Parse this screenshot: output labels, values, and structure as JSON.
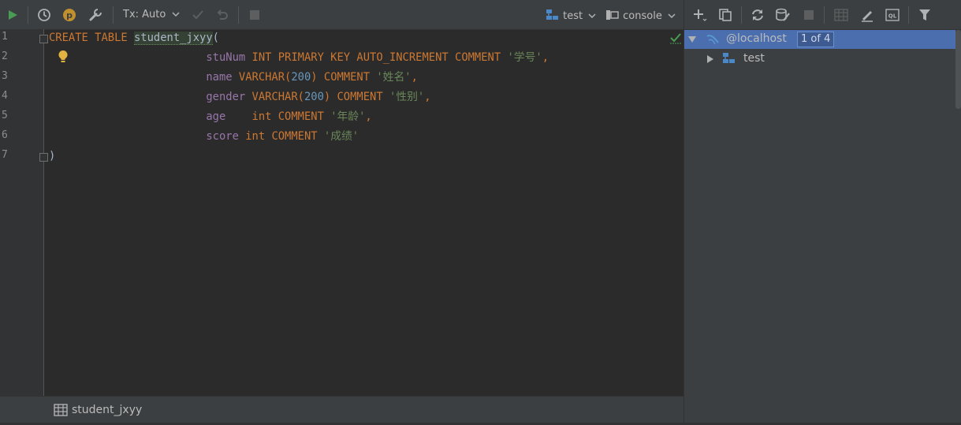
{
  "toolbar": {
    "tx_label": "Tx: Auto",
    "schema_label": "test",
    "console_label": "console"
  },
  "editor": {
    "line_numbers": [
      "1",
      "2",
      "3",
      "4",
      "5",
      "6",
      "7"
    ],
    "lines": [
      [
        {
          "t": "CREATE TABLE ",
          "c": "kw"
        },
        {
          "t": "student_jxyy",
          "c": "tbl"
        },
        {
          "t": "(",
          "c": "ident"
        }
      ],
      [
        {
          "t": "                        ",
          "c": "ident"
        },
        {
          "t": "stuNum",
          "c": "col"
        },
        {
          "t": " INT PRIMARY KEY AUTO_INCREMENT COMMENT ",
          "c": "kw"
        },
        {
          "t": "'学号'",
          "c": "str"
        },
        {
          "t": ",",
          "c": "kw"
        }
      ],
      [
        {
          "t": "                        ",
          "c": "ident"
        },
        {
          "t": "name",
          "c": "col"
        },
        {
          "t": " VARCHAR(",
          "c": "kw"
        },
        {
          "t": "200",
          "c": "num"
        },
        {
          "t": ") COMMENT ",
          "c": "kw"
        },
        {
          "t": "'姓名'",
          "c": "str"
        },
        {
          "t": ",",
          "c": "kw"
        }
      ],
      [
        {
          "t": "                        ",
          "c": "ident"
        },
        {
          "t": "gender",
          "c": "col"
        },
        {
          "t": " VARCHAR(",
          "c": "kw"
        },
        {
          "t": "200",
          "c": "num"
        },
        {
          "t": ") COMMENT ",
          "c": "kw"
        },
        {
          "t": "'性别'",
          "c": "str"
        },
        {
          "t": ",",
          "c": "kw"
        }
      ],
      [
        {
          "t": "                        ",
          "c": "ident"
        },
        {
          "t": "age",
          "c": "col"
        },
        {
          "t": "    int COMMENT ",
          "c": "kw"
        },
        {
          "t": "'年龄'",
          "c": "str"
        },
        {
          "t": ",",
          "c": "kw"
        }
      ],
      [
        {
          "t": "                        ",
          "c": "ident"
        },
        {
          "t": "score",
          "c": "col"
        },
        {
          "t": " int COMMENT ",
          "c": "kw"
        },
        {
          "t": "'成绩'",
          "c": "str"
        }
      ],
      [
        {
          "t": ")",
          "c": "ident"
        }
      ]
    ]
  },
  "footer": {
    "table_name": "student_jxyy"
  },
  "db_tree": {
    "host_label": "@localhost",
    "host_badge": "1 of 4",
    "schema_label": "test"
  },
  "colors": {
    "background": "#2b2b2b",
    "panel": "#3c3f41",
    "selection": "#4b6eaf",
    "keyword": "#cc7832",
    "string": "#6a8759",
    "number": "#6897bb",
    "column": "#9876aa",
    "run_green": "#499c54"
  },
  "icons": [
    "run-icon",
    "history-icon",
    "profile-icon",
    "settings-icon",
    "commit-icon",
    "rollback-icon",
    "stop-icon",
    "schema-icon",
    "console-icon",
    "add-icon",
    "copy-icon",
    "refresh-icon",
    "schema-sync-icon",
    "stop-icon",
    "table-icon",
    "edit-icon",
    "ql-icon",
    "filter-icon",
    "bulb-icon",
    "checkmark-icon",
    "database-icon",
    "expand-icon"
  ]
}
